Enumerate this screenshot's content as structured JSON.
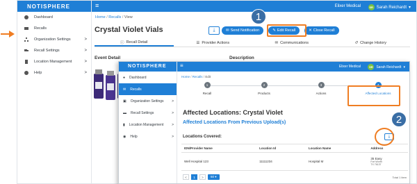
{
  "arrow_color": "#ef7d22",
  "accent_color": "#1f7fd6",
  "highlight_color": "#ef7d22",
  "background_screen": {
    "logo": "NOTISPHERE",
    "org": "Elixer Medical",
    "user_initials": "SR",
    "user_name": "Sarah Reichardt",
    "breadcrumb": {
      "home": "Home",
      "recalls": "Recalls",
      "current": "View"
    },
    "title": "Crystal Violet Vials",
    "buttons": {
      "send": "Send Notification",
      "edit": "Edit Recall",
      "close": "Close Recall"
    },
    "tabs": [
      "Recall Detail",
      "Provider Actions",
      "Communications",
      "Change History"
    ],
    "section_left": "Event Detail",
    "section_right": "Description",
    "step_badge": "1",
    "sidebar": [
      {
        "label": "Dashboard",
        "icon": "palette-icon",
        "chevron": ""
      },
      {
        "label": "Recalls",
        "icon": "envelope-icon",
        "chevron": ""
      },
      {
        "label": "Organization Settings",
        "icon": "sitemap-icon",
        "chevron": ">"
      },
      {
        "label": "Recall Settings",
        "icon": "truck-icon",
        "chevron": ">"
      },
      {
        "label": "Location Management",
        "icon": "building-icon",
        "chevron": ">"
      },
      {
        "label": "Help",
        "icon": "help-icon",
        "chevron": ">"
      }
    ]
  },
  "foreground_screen": {
    "logo": "NOTISPHERE",
    "org": "Elixer Medical",
    "user_initials": "SR",
    "user_name": "Sarah Reichardt",
    "breadcrumb": {
      "home": "Home",
      "recalls": "Recalls",
      "current": "Edit"
    },
    "steps": [
      {
        "num": "1",
        "label": "Recall"
      },
      {
        "num": "2",
        "label": "Products"
      },
      {
        "num": "3",
        "label": "Actions"
      },
      {
        "num": "4",
        "label": "Affected Locations"
      }
    ],
    "title": "Affected Locations: Crystal Violet",
    "subtitle": "Affected Locations From Previous Upload(s)",
    "covered_label": "Locations Covered:",
    "step_badge": "2",
    "sidebar": [
      {
        "label": "Dashboard",
        "chevron": ""
      },
      {
        "label": "Recalls",
        "chevron": ""
      },
      {
        "label": "Organization Settings",
        "chevron": ">"
      },
      {
        "label": "Recall Settings",
        "chevron": ">"
      },
      {
        "label": "Location Management",
        "chevron": ">"
      },
      {
        "label": "Help",
        "chevron": ">"
      }
    ],
    "table": {
      "headers": [
        "IDN/Provider Name",
        "Location Id",
        "Location Name",
        "Address"
      ],
      "rows": [
        {
          "provider": "Well Hospital 123",
          "location_id": "11111234",
          "location_name": "Hospital M",
          "address": "35 Easy",
          "address_line2": "Fort Worth",
          "address_line3": "TX 76137"
        }
      ]
    },
    "pager": {
      "prev": "<",
      "page": "1",
      "next": ">",
      "page_size": "50 ▾"
    },
    "total": "Total 1 item"
  }
}
